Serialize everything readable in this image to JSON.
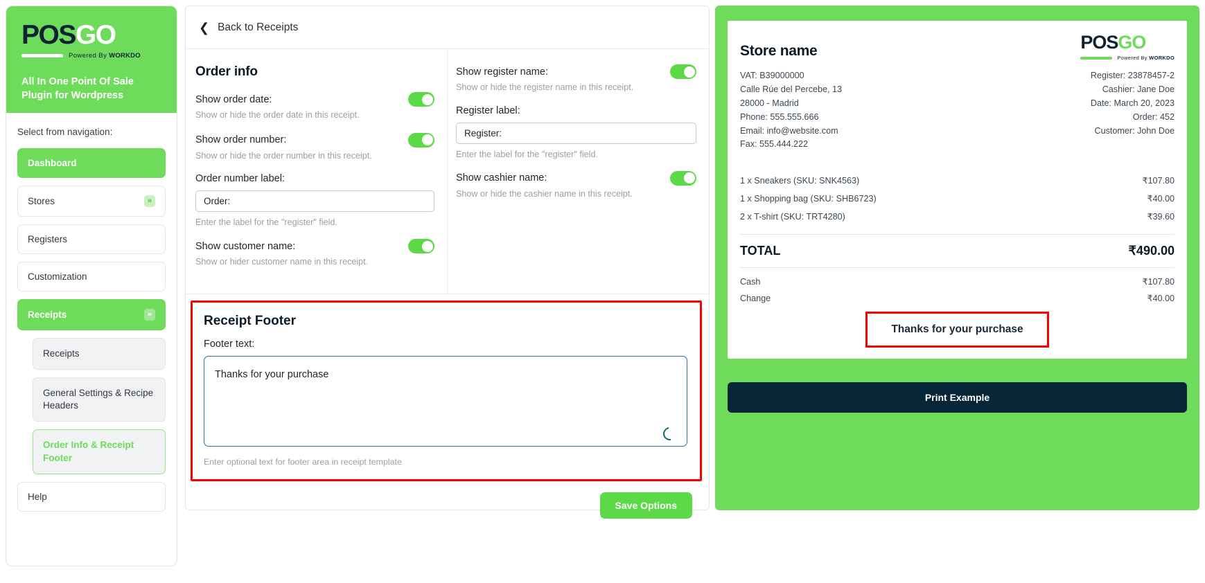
{
  "brand": {
    "logo_pos": "POS",
    "logo_go": "GO",
    "powered_prefix": "Powered By ",
    "powered_name": "WORKDO",
    "tagline": "All In One Point Of Sale Plugin for Wordpress"
  },
  "sidebar": {
    "nav_heading": "Select from navigation:",
    "items": [
      {
        "label": "Dashboard",
        "active": true,
        "badge": ""
      },
      {
        "label": "Stores",
        "active": false,
        "badge": "»"
      },
      {
        "label": "Registers",
        "active": false,
        "badge": ""
      },
      {
        "label": "Customization",
        "active": false,
        "badge": ""
      },
      {
        "label": "Receipts",
        "active": true,
        "badge": "»"
      }
    ],
    "subitems": [
      {
        "label": "Receipts",
        "current": false
      },
      {
        "label": "General Settings & Recipe Headers",
        "current": false
      },
      {
        "label": "Order Info & Receipt Footer",
        "current": true
      }
    ],
    "help": {
      "label": "Help"
    }
  },
  "header": {
    "back_label": "Back to Receipts",
    "back_icon": "chevron-left-icon"
  },
  "order_info": {
    "title": "Order info",
    "show_order_date": {
      "label": "Show order date:",
      "hint": "Show or hide the order date in this receipt.",
      "value": "on"
    },
    "show_order_number": {
      "label": "Show order number:",
      "hint": "Show or hide the order number in this receipt.",
      "value": "on"
    },
    "order_number_label": {
      "label": "Order number label:",
      "value": "Order:",
      "hint": "Enter the label for the \"register\" field."
    },
    "show_customer_name": {
      "label": "Show customer name:",
      "hint": "Show or hider customer name in this receipt.",
      "value": "on"
    },
    "show_register_name": {
      "label": "Show register name:",
      "hint": "Show or hide the register name in this receipt.",
      "value": "on"
    },
    "register_label": {
      "label": "Register label:",
      "value": "Register:",
      "hint": "Enter the label for the \"register\" field."
    },
    "show_cashier_name": {
      "label": "Show cashier name:",
      "hint": "Show or hide the cashier name in this receipt.",
      "value": "on"
    }
  },
  "receipt_footer": {
    "title": "Receipt Footer",
    "field_label": "Footer text:",
    "value": "Thanks for your purchase",
    "hint": "Enter optional text for footer area in receipt template",
    "spinner_icon": "loading-spinner-icon"
  },
  "actions": {
    "save_label": "Save Options",
    "print_label": "Print Example"
  },
  "receipt_preview": {
    "store_name": "Store name",
    "left_meta": [
      "VAT: B39000000",
      "Calle Rúe del Percebe, 13",
      "28000 - Madrid",
      "Phone: 555.555.666",
      "Email: info@website.com",
      "Fax: 555.444.222"
    ],
    "right_meta": [
      "Register: 23878457-2",
      "Cashier: Jane Doe",
      "Date: March 20, 2023",
      "Order: 452",
      "Customer: John Doe"
    ],
    "items": [
      {
        "desc": "1 x Sneakers (SKU: SNK4563)",
        "price": "₹107.80"
      },
      {
        "desc": "1 x Shopping bag (SKU: SHB6723)",
        "price": "₹40.00"
      },
      {
        "desc": "2 x T-shirt (SKU: TRT4280)",
        "price": "₹39.60"
      }
    ],
    "total_label": "TOTAL",
    "total_value": "₹490.00",
    "payments": [
      {
        "label": "Cash",
        "value": "₹107.80"
      },
      {
        "label": "Change",
        "value": "₹40.00"
      }
    ],
    "footer_text": "Thanks for your purchase"
  },
  "colors": {
    "brand_green": "#6edb5b",
    "toggle_green": "#5cd946",
    "highlight_red": "#fc0000",
    "dark_navy": "#062637",
    "focus_blue": "#2b6ca3"
  }
}
